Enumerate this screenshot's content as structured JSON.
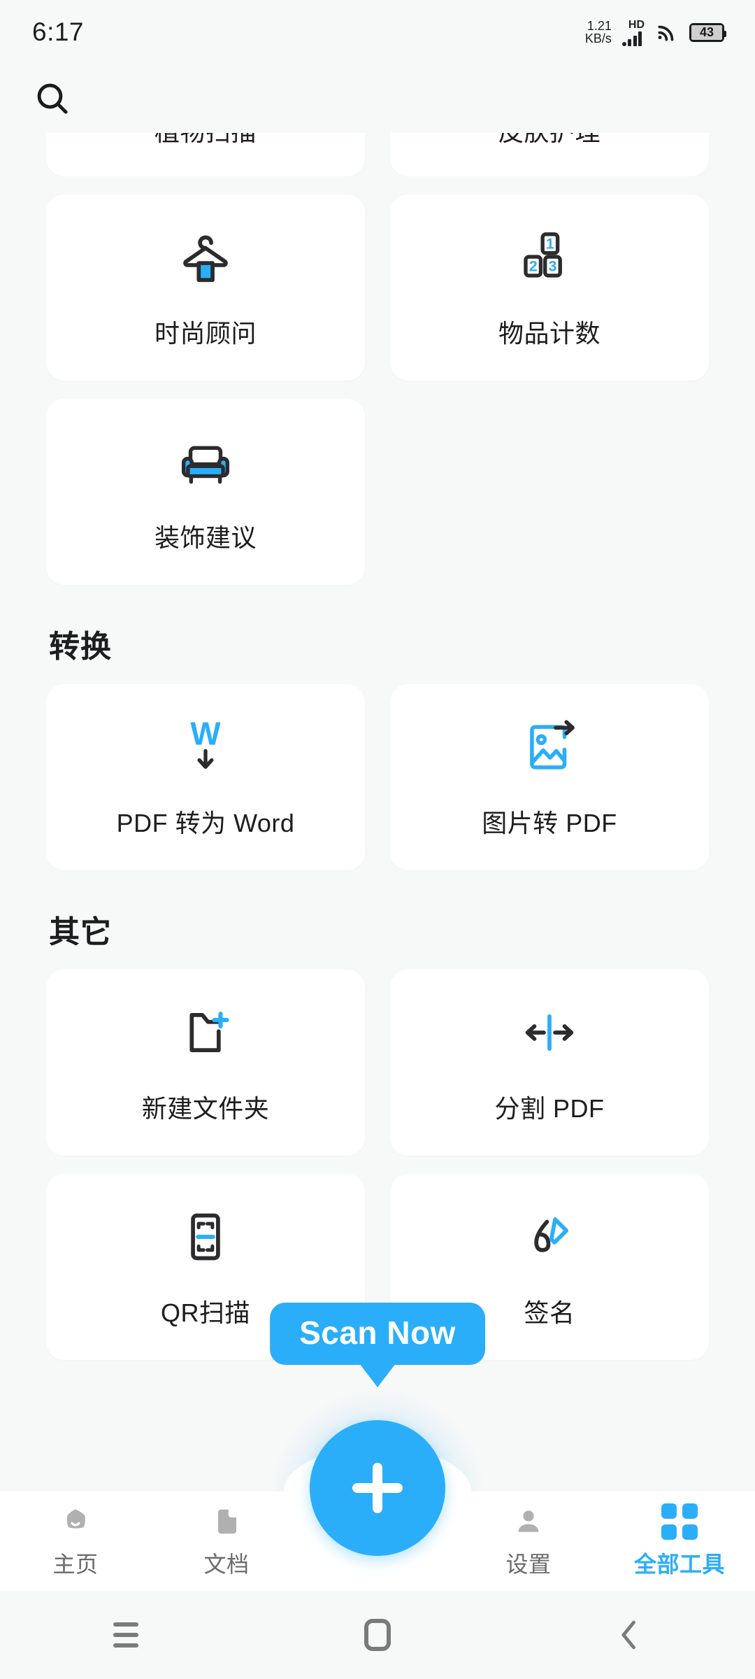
{
  "statusbar": {
    "clock": "6:17",
    "netspeed_value": "1.21",
    "netspeed_unit": "KB/s",
    "hd_label": "HD",
    "battery_level": "43",
    "icons": [
      "signal-icon",
      "wifi-icon",
      "battery-icon"
    ]
  },
  "appbar": {
    "search_icon": "search-icon"
  },
  "clipped_section": {
    "cards": [
      {
        "label": "植物扫描",
        "icon": "plant-scan-icon"
      },
      {
        "label": "皮肤护理",
        "icon": "skin-care-icon"
      }
    ]
  },
  "ai_section": {
    "cards": [
      {
        "label": "时尚顾问",
        "icon": "clothes-hanger-icon"
      },
      {
        "label": "物品计数",
        "icon": "counting-blocks-icon",
        "block_numbers": [
          "1",
          "2",
          "3"
        ]
      },
      {
        "label": "装饰建议",
        "icon": "sofa-icon"
      }
    ]
  },
  "convert_section": {
    "title": "转换",
    "cards": [
      {
        "label": "PDF 转为 Word",
        "icon": "word-convert-icon",
        "glyph": "W"
      },
      {
        "label": "图片转 PDF",
        "icon": "image-to-pdf-icon"
      }
    ]
  },
  "other_section": {
    "title": "其它",
    "cards": [
      {
        "label": "新建文件夹",
        "icon": "new-folder-icon"
      },
      {
        "label": "分割 PDF",
        "icon": "split-pdf-icon"
      },
      {
        "label": "QR扫描",
        "icon": "qr-scan-icon"
      },
      {
        "label": "签名",
        "icon": "signature-icon"
      }
    ]
  },
  "tooltip": {
    "text": "Scan Now"
  },
  "fab": {
    "icon": "plus-icon"
  },
  "bottomnav": {
    "items": [
      {
        "label": "主页",
        "icon": "home-icon",
        "active": false
      },
      {
        "label": "文档",
        "icon": "document-icon",
        "active": false
      },
      {
        "label": "设置",
        "icon": "person-icon",
        "active": false
      },
      {
        "label": "全部工具",
        "icon": "grid-icon",
        "active": true
      }
    ]
  },
  "sysnav": {
    "buttons": [
      "recents-icon",
      "home-square-icon",
      "back-chevron-icon"
    ]
  },
  "colors": {
    "accent": "#2BAEF9",
    "page_bg": "#F7F8F8",
    "card_bg": "#FFFFFF",
    "text_primary": "#1D1D1F",
    "text_muted": "#6B6B6B"
  }
}
